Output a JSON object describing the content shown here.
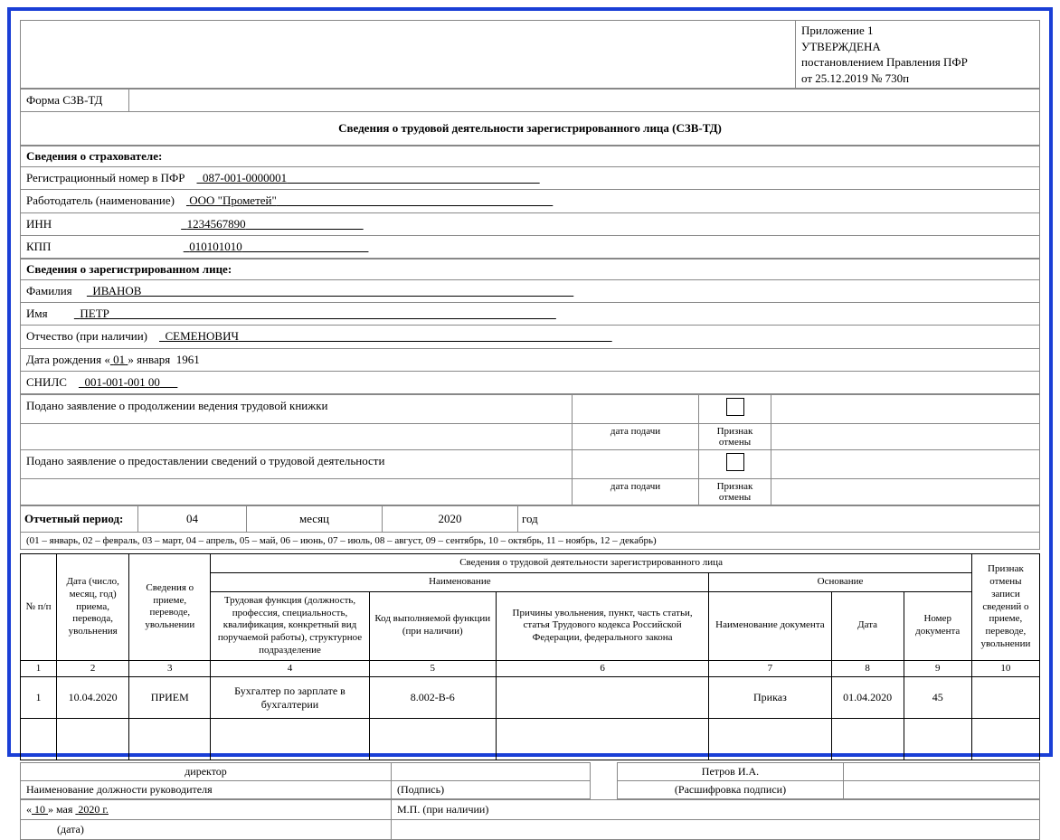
{
  "approval": {
    "annex": "Приложение 1",
    "approved": "УТВЕРЖДЕНА",
    "by": "постановлением Правления ПФР",
    "date_line": "от 25.12.2019   № 730п"
  },
  "form_code": "Форма СЗВ-ТД",
  "title": "Сведения о трудовой деятельности зарегистрированного лица (СЗВ-ТД)",
  "insurer": {
    "header": "Сведения о страхователе:",
    "reg_label": "Регистрационный номер в ПФР",
    "reg_value": "087-001-0000001",
    "employer_label": "Работодатель (наименование)",
    "employer_value": "ООО \"Прометей\"",
    "inn_label": "ИНН",
    "inn_value": "1234567890",
    "kpp_label": "КПП",
    "kpp_value": "010101010"
  },
  "person": {
    "header": "Сведения о зарегистрированном лице:",
    "lastname_label": "Фамилия",
    "lastname": "ИВАНОВ",
    "firstname_label": "Имя",
    "firstname": "ПЕТР",
    "patronymic_label": "Отчество (при наличии)",
    "patronymic": "СЕМЕНОВИЧ",
    "dob_label": "Дата рождения «",
    "dob_day": "01",
    "dob_between": "» ",
    "dob_month": "января",
    "dob_year": "1961",
    "snils_label": "СНИЛС",
    "snils": "001-001-001 00"
  },
  "applications": {
    "continue_line": "Подано заявление о продолжении ведения трудовой книжки",
    "provide_line": "Подано заявление о предоставлении сведений о трудовой деятельности",
    "date_hint": "дата подачи",
    "cancel_hint": "Признак отмены"
  },
  "period": {
    "label": "Отчетный период:",
    "month_value": "04",
    "month_word": "месяц",
    "year_value": "2020",
    "year_word": "год",
    "months_note": "(01 – январь, 02 – февраль, 03 – март, 04 – апрель, 05 – май, 06 – июнь, 07 – июль, 08 – август, 09 – сентябрь, 10 – октябрь, 11 – ноябрь, 12 – декабрь)"
  },
  "table": {
    "super_header": "Сведения о трудовой деятельности зарегистрированного лица",
    "naming_header": "Наименование",
    "basis_header": "Основание",
    "cancel_header": "Признак отмены записи сведений о приеме, переводе, увольнении",
    "cols": {
      "c1": "№ п/п",
      "c2": "Дата (число, месяц, год) приема, перевода, увольнения",
      "c3": "Сведения о приеме, переводе, увольнении",
      "c4": "Трудовая функция (должность, профессия, специальность, квалификация, конкретный вид поручаемой работы), структурное подразделение",
      "c5": "Код выполняемой функции (при наличии)",
      "c6": "Причины увольнения, пункт, часть статьи, статья Трудового кодекса Российской Федерации, федерального закона",
      "c7": "Наименование документа",
      "c8": "Дата",
      "c9": "Номер документа"
    },
    "nums": [
      "1",
      "2",
      "3",
      "4",
      "5",
      "6",
      "7",
      "8",
      "9",
      "10"
    ],
    "row": {
      "n": "1",
      "date": "10.04.2020",
      "action": "ПРИЕМ",
      "func": "Бухгалтер по зарплате в бухгалтерии",
      "code": "8.002-B-6",
      "reason": "",
      "doc_name": "Приказ",
      "doc_date": "01.04.2020",
      "doc_num": "45",
      "cancel": ""
    }
  },
  "sign": {
    "position": "директор",
    "position_hint": "Наименование должности руководителя",
    "sign_hint": "(Подпись)",
    "decoded": "Петров И.А.",
    "decoded_hint": "(Расшифровка подписи)",
    "date_line_prefix": "«",
    "date_day": "10",
    "date_mid": "»",
    "date_month": "мая",
    "date_year": "2020 г.",
    "date_hint": "(дата)",
    "mp": "М.П. (при наличии)"
  }
}
